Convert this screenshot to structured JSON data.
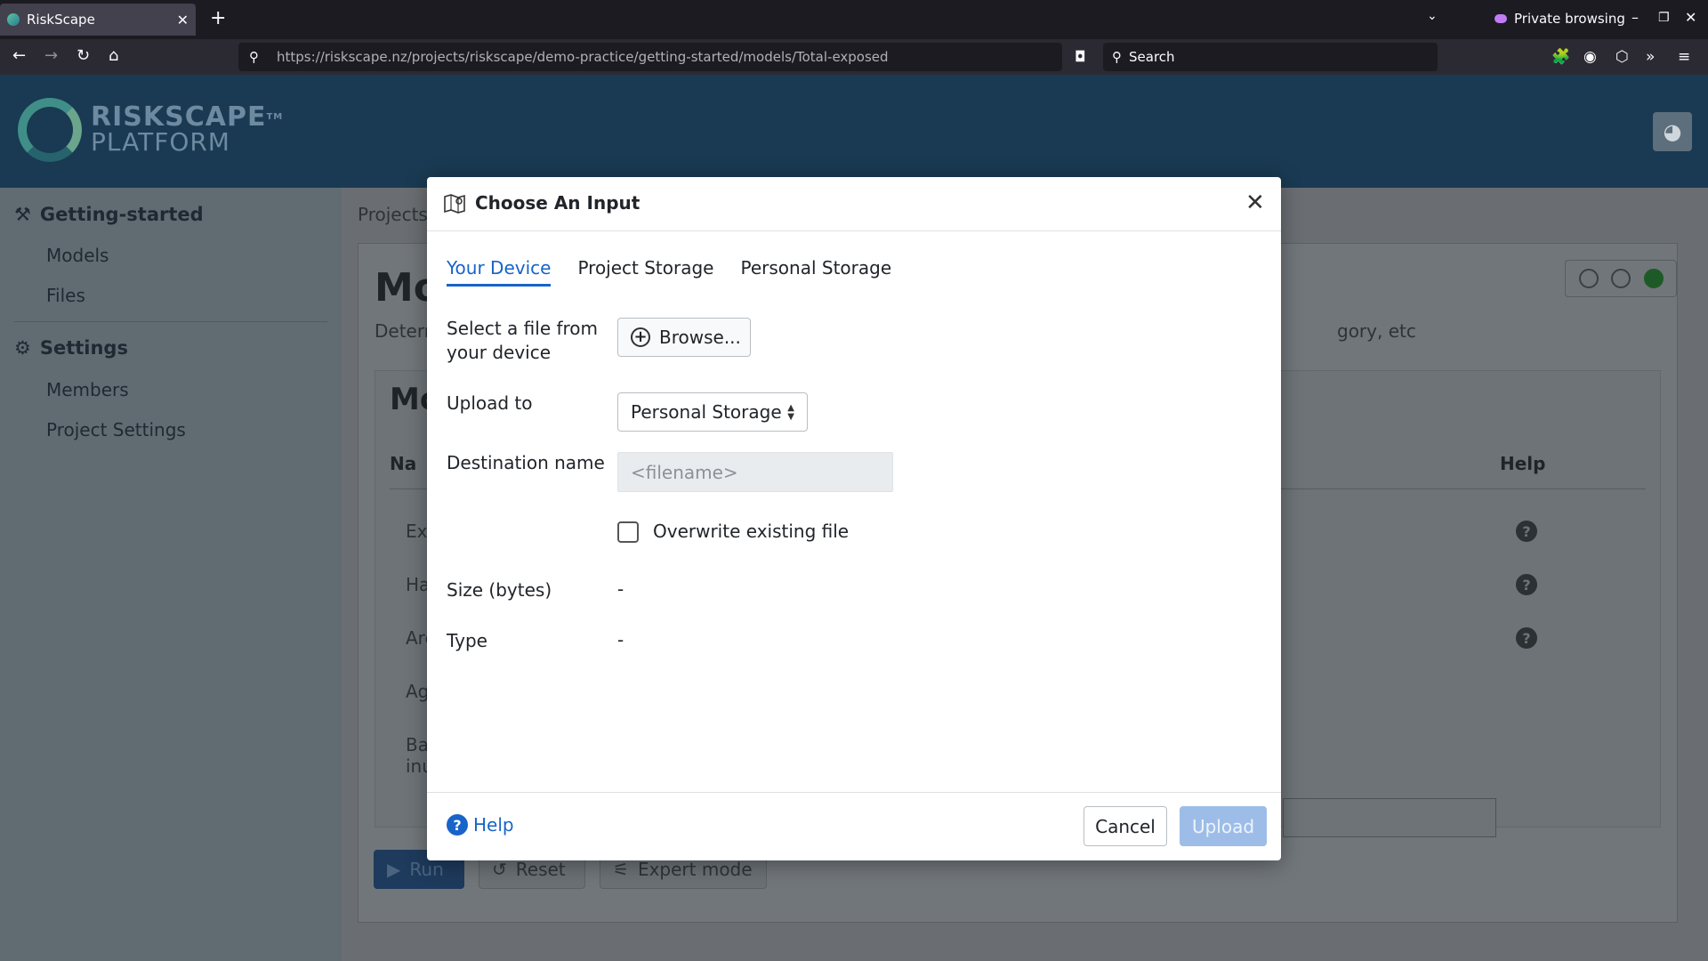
{
  "browser": {
    "tab_title": "RiskScape",
    "private_label": "Private browsing",
    "url": "https://riskscape.nz/projects/riskscape/demo-practice/getting-started/models/Total-exposed",
    "search_placeholder": "Search"
  },
  "header": {
    "logo_line1": "RISKSCAPE",
    "logo_line2": "PLATFORM",
    "logo_tm": "TM"
  },
  "sidebar": {
    "group1_label": "Getting-started",
    "group1_items": [
      "Models",
      "Files"
    ],
    "group2_label": "Settings",
    "group2_items": [
      "Members",
      "Project Settings"
    ]
  },
  "main": {
    "breadcrumb": "Projects",
    "title_fragment": "Mo",
    "desc_fragment_left": "Deterr",
    "desc_fragment_right": "gory, etc",
    "inner_title_fragment": "Mo",
    "col_name_fragment": "Na",
    "col_help": "Help",
    "row_fragments": [
      "Ex",
      "Ha",
      "Are",
      "Ag",
      "Ba",
      "inu"
    ],
    "run_label": "Run",
    "reset_label": "Reset",
    "expert_label": "Expert mode"
  },
  "modal": {
    "title": "Choose An Input",
    "tabs": [
      "Your Device",
      "Project Storage",
      "Personal Storage"
    ],
    "select_file_label_line1": "Select a file from",
    "select_file_label_line2": "your device",
    "browse_label": "Browse...",
    "upload_to_label": "Upload to",
    "upload_to_value": "Personal Storage",
    "destination_label": "Destination name",
    "destination_placeholder": "<filename>",
    "overwrite_label": "Overwrite existing file",
    "size_label": "Size (bytes)",
    "size_value": "-",
    "type_label": "Type",
    "type_value": "-",
    "help_label": "Help",
    "cancel_label": "Cancel",
    "upload_label": "Upload"
  },
  "colors": {
    "accent": "#1864c8",
    "header_bg": "#193a52",
    "upload_disabled": "#9dbde8"
  }
}
